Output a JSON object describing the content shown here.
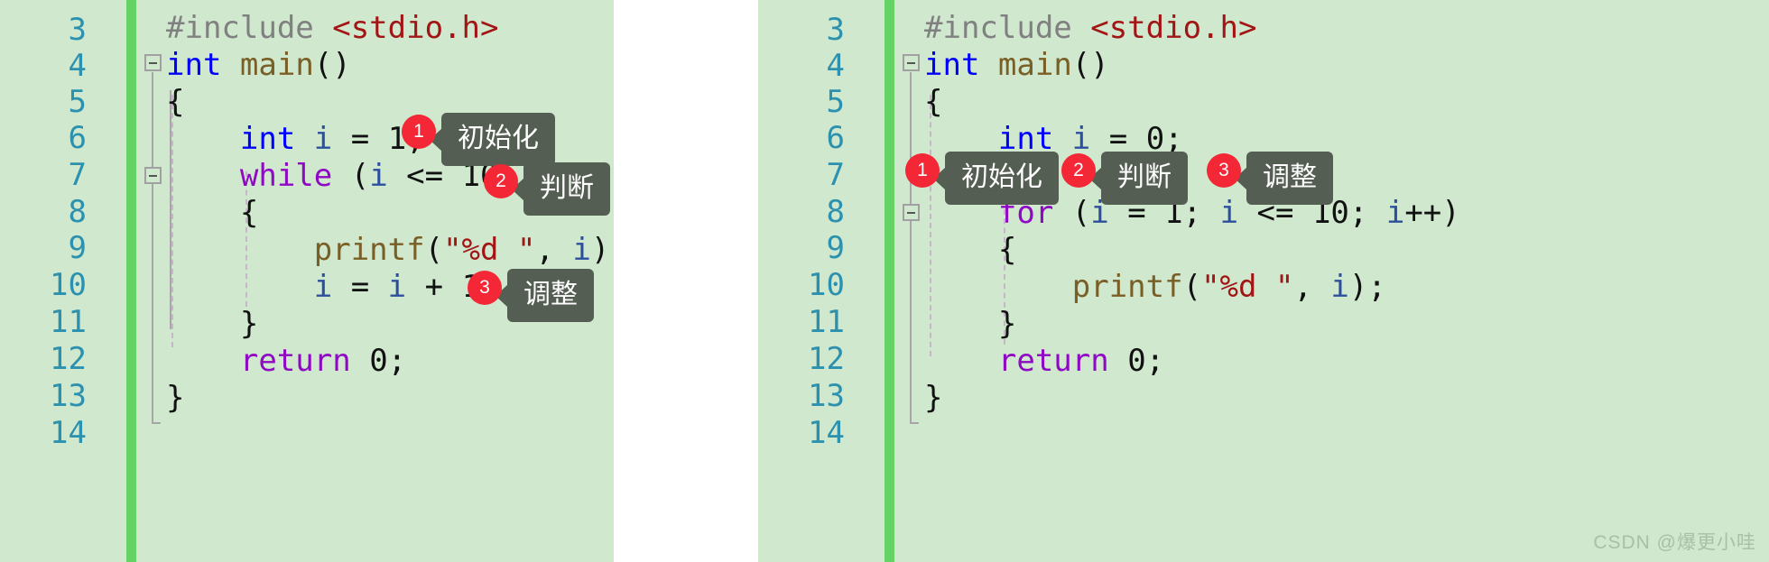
{
  "theme": {
    "editor_background": "#cfe8ce",
    "line_number_color": "#2b91af",
    "change_bar_color": "#64d264",
    "badge_color": "#f32735",
    "tooltip_background": "#555e52",
    "tooltip_text_color": "#ffffff",
    "keyword_color": "#0000ff",
    "control_keyword_color": "#8f08c4",
    "string_color": "#a31515",
    "function_color": "#795e26",
    "preprocessor_color": "#808080",
    "variable_color": "#2b4f9e",
    "page_background": "#ffffff"
  },
  "left_panel": {
    "name": "while-loop-example",
    "line_numbers": [
      "3",
      "4",
      "5",
      "6",
      "7",
      "8",
      "9",
      "10",
      "11",
      "12",
      "13",
      "14"
    ],
    "code_lines": [
      {
        "number": "3",
        "tokens": [
          {
            "t": "pre",
            "s": "#include "
          },
          {
            "t": "str",
            "s": "<stdio.h>"
          }
        ]
      },
      {
        "number": "4",
        "tokens": [
          {
            "t": "kw",
            "s": "int"
          },
          {
            "t": "plain",
            "s": " "
          },
          {
            "t": "fn",
            "s": "main"
          },
          {
            "t": "plain",
            "s": "()"
          }
        ]
      },
      {
        "number": "5",
        "tokens": [
          {
            "t": "plain",
            "s": "{"
          }
        ]
      },
      {
        "number": "6",
        "tokens": [
          {
            "t": "kw",
            "s": "int"
          },
          {
            "t": "plain",
            "s": " "
          },
          {
            "t": "var",
            "s": "i"
          },
          {
            "t": "plain",
            "s": " = 1;"
          }
        ]
      },
      {
        "number": "7",
        "tokens": [
          {
            "t": "ctl",
            "s": "while"
          },
          {
            "t": "plain",
            "s": " ("
          },
          {
            "t": "var",
            "s": "i"
          },
          {
            "t": "plain",
            "s": " <= 10)"
          }
        ]
      },
      {
        "number": "8",
        "tokens": [
          {
            "t": "plain",
            "s": "{"
          }
        ]
      },
      {
        "number": "9",
        "tokens": [
          {
            "t": "fn",
            "s": "printf"
          },
          {
            "t": "plain",
            "s": "("
          },
          {
            "t": "str",
            "s": "\"%d \""
          },
          {
            "t": "plain",
            "s": ", "
          },
          {
            "t": "var",
            "s": "i"
          },
          {
            "t": "plain",
            "s": ");"
          }
        ]
      },
      {
        "number": "10",
        "tokens": [
          {
            "t": "var",
            "s": "i"
          },
          {
            "t": "plain",
            "s": " = "
          },
          {
            "t": "var",
            "s": "i"
          },
          {
            "t": "plain",
            "s": " + 1;"
          }
        ]
      },
      {
        "number": "11",
        "tokens": [
          {
            "t": "plain",
            "s": "}"
          }
        ]
      },
      {
        "number": "12",
        "tokens": [
          {
            "t": "ctl",
            "s": "return"
          },
          {
            "t": "plain",
            "s": " 0;"
          }
        ]
      },
      {
        "number": "13",
        "tokens": [
          {
            "t": "plain",
            "s": "}"
          }
        ]
      },
      {
        "number": "14",
        "tokens": []
      }
    ],
    "annotations": [
      {
        "number": "1",
        "label": "初始化",
        "for_line": "6"
      },
      {
        "number": "2",
        "label": "判断",
        "for_line": "7"
      },
      {
        "number": "3",
        "label": "调整",
        "for_line": "10"
      }
    ]
  },
  "right_panel": {
    "name": "for-loop-example",
    "line_numbers": [
      "3",
      "4",
      "5",
      "6",
      "7",
      "8",
      "9",
      "10",
      "11",
      "12",
      "13",
      "14"
    ],
    "code_lines": [
      {
        "number": "3",
        "tokens": [
          {
            "t": "pre",
            "s": "#include "
          },
          {
            "t": "str",
            "s": "<stdio.h>"
          }
        ]
      },
      {
        "number": "4",
        "tokens": [
          {
            "t": "kw",
            "s": "int"
          },
          {
            "t": "plain",
            "s": " "
          },
          {
            "t": "fn",
            "s": "main"
          },
          {
            "t": "plain",
            "s": "()"
          }
        ]
      },
      {
        "number": "5",
        "tokens": [
          {
            "t": "plain",
            "s": "{"
          }
        ]
      },
      {
        "number": "6",
        "tokens": [
          {
            "t": "kw",
            "s": "int"
          },
          {
            "t": "plain",
            "s": " "
          },
          {
            "t": "var",
            "s": "i"
          },
          {
            "t": "plain",
            "s": " = 0;"
          }
        ]
      },
      {
        "number": "7",
        "tokens": []
      },
      {
        "number": "8",
        "tokens": [
          {
            "t": "ctl",
            "s": "for"
          },
          {
            "t": "plain",
            "s": " ("
          },
          {
            "t": "var",
            "s": "i"
          },
          {
            "t": "plain",
            "s": " = 1; "
          },
          {
            "t": "var",
            "s": "i"
          },
          {
            "t": "plain",
            "s": " <= 10; "
          },
          {
            "t": "var",
            "s": "i"
          },
          {
            "t": "plain",
            "s": "++)"
          }
        ]
      },
      {
        "number": "9",
        "tokens": [
          {
            "t": "plain",
            "s": "{"
          }
        ]
      },
      {
        "number": "10",
        "tokens": [
          {
            "t": "fn",
            "s": "printf"
          },
          {
            "t": "plain",
            "s": "("
          },
          {
            "t": "str",
            "s": "\"%d \""
          },
          {
            "t": "plain",
            "s": ", "
          },
          {
            "t": "var",
            "s": "i"
          },
          {
            "t": "plain",
            "s": ");"
          }
        ]
      },
      {
        "number": "11",
        "tokens": [
          {
            "t": "plain",
            "s": "}"
          }
        ]
      },
      {
        "number": "12",
        "tokens": [
          {
            "t": "ctl",
            "s": "return"
          },
          {
            "t": "plain",
            "s": " 0;"
          }
        ]
      },
      {
        "number": "13",
        "tokens": [
          {
            "t": "plain",
            "s": "}"
          }
        ]
      },
      {
        "number": "14",
        "tokens": []
      }
    ],
    "annotations": [
      {
        "number": "1",
        "label": "初始化",
        "for_line": "8"
      },
      {
        "number": "2",
        "label": "判断",
        "for_line": "8"
      },
      {
        "number": "3",
        "label": "调整",
        "for_line": "8"
      }
    ]
  },
  "watermark": {
    "text": "CSDN @爆更小哇"
  }
}
